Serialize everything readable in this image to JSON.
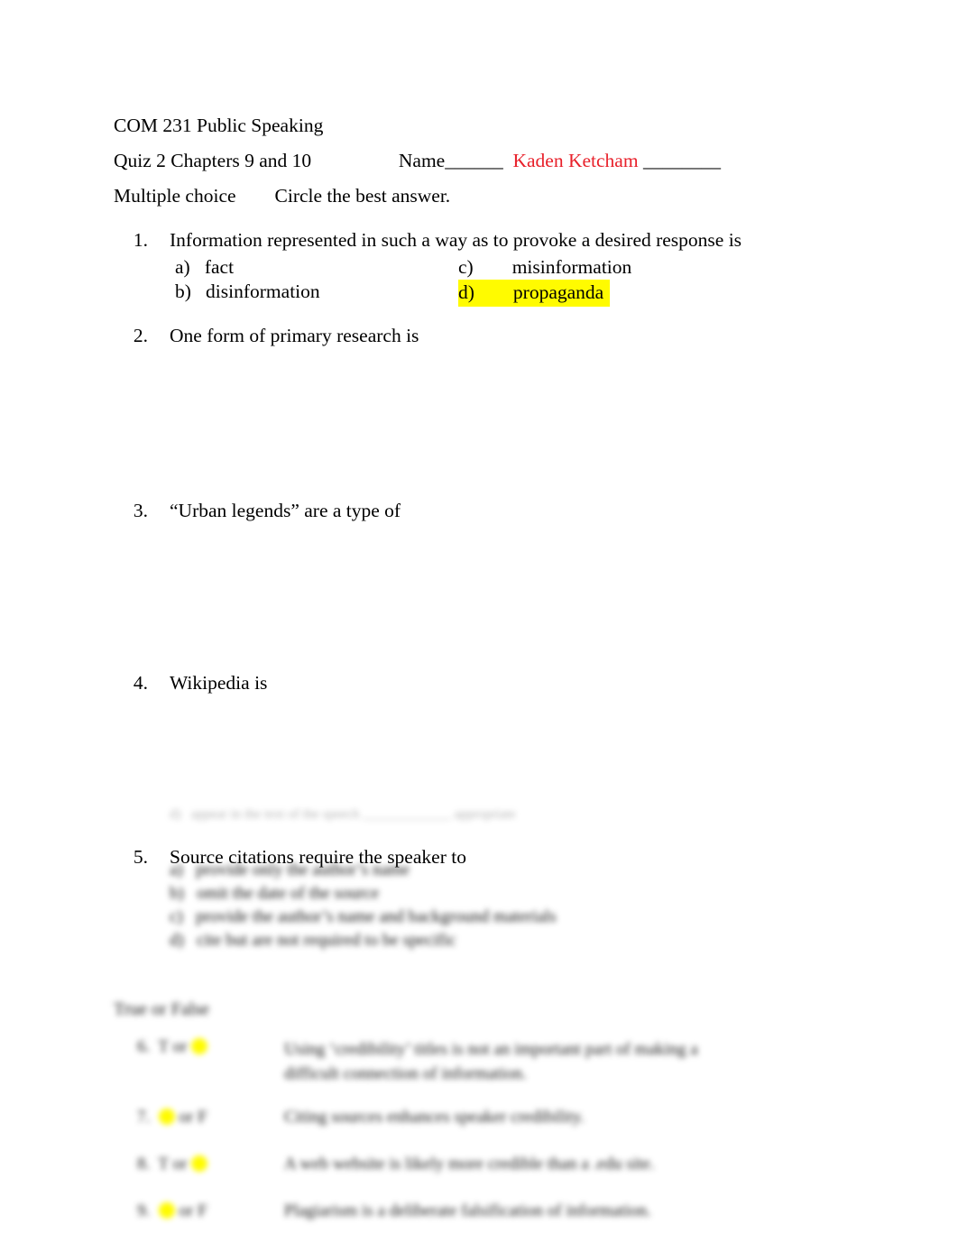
{
  "document": {
    "course_title": "COM 231 Public Speaking",
    "quiz_line": {
      "quiz_label": "Quiz 2 Chapters 9 and 10",
      "name_label": "Name______",
      "student_name": "Kaden Ketcham",
      "name_trailing": "________"
    },
    "instructions": "Multiple choice        Circle the best answer.",
    "questions": [
      {
        "number": "1.",
        "text": "Information represented in such a way as to provoke a desired response is",
        "options": [
          {
            "letter": "a)",
            "label": "fact",
            "highlighted": false
          },
          {
            "letter": "b)",
            "label": "disinformation",
            "highlighted": false
          },
          {
            "letter": "c)",
            "label": "misinformation",
            "highlighted": false
          },
          {
            "letter": "d)",
            "label": "propaganda",
            "highlighted": true
          }
        ]
      },
      {
        "number": "2.",
        "text": "One form of primary research is",
        "options": []
      },
      {
        "number": "3.",
        "text": "“Urban legends” are a type of",
        "options": []
      },
      {
        "number": "4.",
        "text": "Wikipedia is",
        "options": []
      },
      {
        "number": "5.",
        "text": "Source citations require the speaker to",
        "options": [
          {
            "letter": "a)",
            "label": "provide only the author’s name",
            "highlighted": false
          },
          {
            "letter": "b)",
            "label": "omit the date of the source",
            "highlighted": false
          },
          {
            "letter": "c)",
            "label": "provide the author’s name and background materials",
            "highlighted": false
          },
          {
            "letter": "d)",
            "label": "cite but are not required to be specific",
            "highlighted": false
          }
        ]
      }
    ],
    "faint_cut_line": "d)   appear in the text of the speech _____________ appropriate",
    "true_false": {
      "heading": "True or False",
      "rows": [
        {
          "number": "6.",
          "t_label": "T",
          "or_label": "or",
          "f_label": "F",
          "marked": "F",
          "statement": "Using ‘credibility’ titles is not an important part of making a difficult connection of information."
        },
        {
          "number": "7.",
          "t_label": "T",
          "or_label": "or",
          "f_label": "F",
          "marked": "T",
          "statement": "Citing sources enhances speaker credibility."
        },
        {
          "number": "8.",
          "t_label": "T",
          "or_label": "or",
          "f_label": "F",
          "marked": "F",
          "statement": "A web website is likely more credible than a .edu site."
        },
        {
          "number": "9.",
          "t_label": "T",
          "or_label": "or",
          "f_label": "F",
          "marked": "T",
          "statement": "Plagiarism is a deliberate falsification of information."
        }
      ]
    }
  }
}
